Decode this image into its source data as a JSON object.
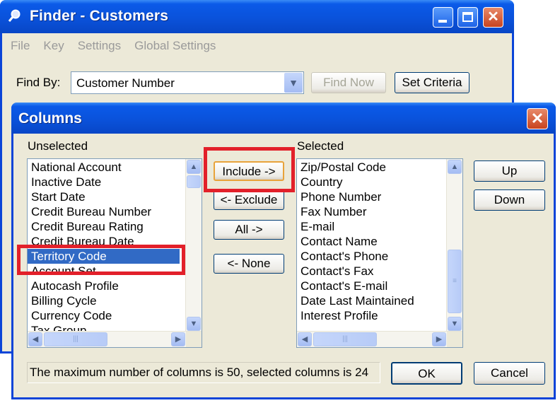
{
  "finder": {
    "title": "Finder - Customers",
    "menu": [
      "File",
      "Key",
      "Settings",
      "Global Settings"
    ],
    "find_by_label": "Find By:",
    "find_by_value": "Customer Number",
    "find_now_label": "Find Now",
    "set_criteria_label": "Set Criteria"
  },
  "dialog": {
    "title": "Columns",
    "unselected_label": "Unselected",
    "selected_label": "Selected",
    "unselected_items": [
      "National Account",
      "Inactive Date",
      "Start Date",
      "Credit Bureau Number",
      "Credit Bureau Rating",
      "Credit Bureau Date",
      "Territory Code",
      "Account Set",
      "Autocash Profile",
      "Billing Cycle",
      "Currency Code",
      "Tax Group"
    ],
    "selected_unselected_item": "Territory Code",
    "selected_items": [
      "Zip/Postal Code",
      "Country",
      "Phone Number",
      "Fax Number",
      "E-mail",
      "Contact Name",
      "Contact's Phone",
      "Contact's Fax",
      "Contact's E-mail",
      "Date Last Maintained",
      "Interest Profile"
    ],
    "include_label": "Include ->",
    "exclude_label": "<- Exclude",
    "all_label": "All ->",
    "none_label": "<- None",
    "up_label": "Up",
    "down_label": "Down",
    "status_text": "The maximum number of columns is 50, selected columns is 24",
    "ok_label": "OK",
    "cancel_label": "Cancel"
  },
  "icons": {
    "title_icon": "magnifier-icon",
    "scroll_up": "▲",
    "scroll_down": "▼",
    "scroll_left": "◀",
    "scroll_right": "▶"
  },
  "colors": {
    "titlebar": "#0a52db",
    "selection": "#316ac5",
    "highlight_box": "#e2202a"
  }
}
